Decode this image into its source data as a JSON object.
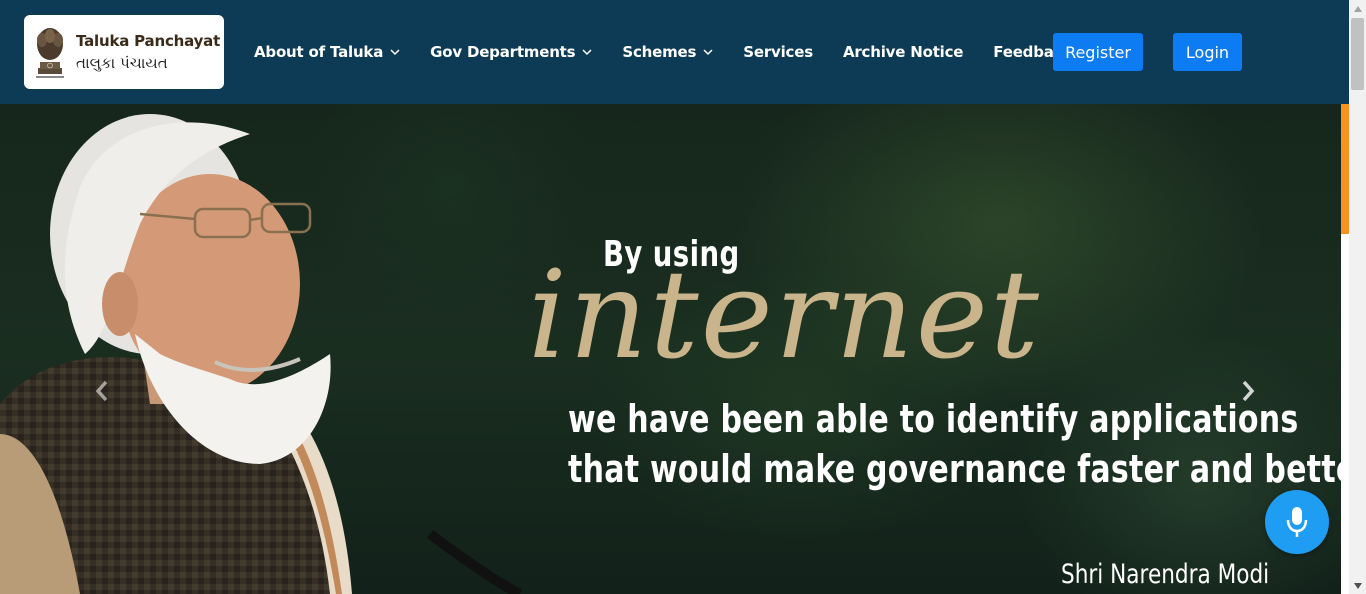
{
  "brand": {
    "title_en": "Taluka Panchayat",
    "title_gu": "તાલુકા પંચાયત",
    "emblem_icon": "ashoka-emblem-icon"
  },
  "nav": {
    "items": [
      {
        "label": "About of Taluka",
        "dropdown": true
      },
      {
        "label": "Gov Departments",
        "dropdown": true
      },
      {
        "label": "Schemes",
        "dropdown": true
      },
      {
        "label": "Services",
        "dropdown": false
      },
      {
        "label": "Archive Notice",
        "dropdown": false
      },
      {
        "label": "Feedback",
        "dropdown": false
      }
    ],
    "register_label": "Register",
    "login_label": "Login"
  },
  "hero": {
    "line_top": "By using",
    "line_big": "internet",
    "line_1": "we have been able to identify applications",
    "line_2": "that would make governance faster and better.",
    "author": "Shri Narendra Modi",
    "prev_icon": "chevron-left-icon",
    "next_icon": "chevron-right-icon"
  },
  "voice": {
    "icon": "microphone-icon"
  },
  "colors": {
    "header_bg": "#0d3b55",
    "button_blue": "#0d7cf2",
    "accent_gold": "#c9b48c",
    "accent_orange": "#f7931e",
    "mic_blue": "#1e9df2"
  }
}
